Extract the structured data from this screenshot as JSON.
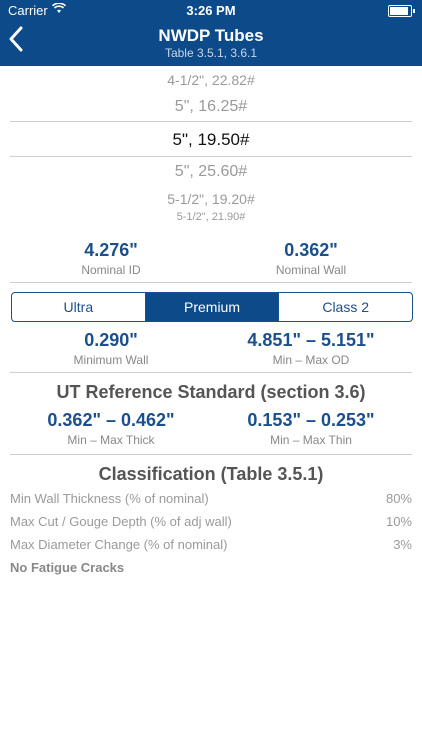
{
  "status_bar": {
    "carrier": "Carrier",
    "time": "3:26 PM"
  },
  "header": {
    "back_icon": "chevron-left-icon",
    "title": "NWDP Tubes",
    "subtitle": "Table 3.5.1, 3.6.1"
  },
  "picker": {
    "items": [
      "4-1/2\", 22.82#",
      "5\", 16.25#",
      "5\", 19.50#",
      "5\", 25.60#",
      "5-1/2\", 19.20#",
      "5-1/2\", 21.90#"
    ],
    "selected": "5\", 19.50#"
  },
  "nominal": {
    "id_value": "4.276\"",
    "id_label": "Nominal ID",
    "wall_value": "0.362\"",
    "wall_label": "Nominal Wall"
  },
  "segmented": {
    "options": [
      "Ultra",
      "Premium",
      "Class 2"
    ],
    "selected": "Premium"
  },
  "limits": {
    "min_wall_value": "0.290\"",
    "min_wall_label": "Minimum Wall",
    "od_value": "4.851\" – 5.151\"",
    "od_label": "Min – Max OD"
  },
  "ut_reference": {
    "title": "UT Reference Standard (section 3.6)",
    "thick_value": "0.362\" – 0.462\"",
    "thick_label": "Min – Max Thick",
    "thin_value": "0.153\" – 0.253\"",
    "thin_label": "Min – Max Thin"
  },
  "classification": {
    "title": "Classification (Table 3.5.1)",
    "rows": [
      {
        "label": "Min Wall Thickness (% of nominal)",
        "value": "80%"
      },
      {
        "label": "Max Cut / Gouge Depth (% of adj wall)",
        "value": "10%"
      },
      {
        "label": "Max Diameter Change (% of nominal)",
        "value": "3%"
      }
    ],
    "note": "No Fatigue Cracks"
  },
  "colors": {
    "header_bg": "#0d4a8a",
    "accent": "#1b4f8d"
  }
}
